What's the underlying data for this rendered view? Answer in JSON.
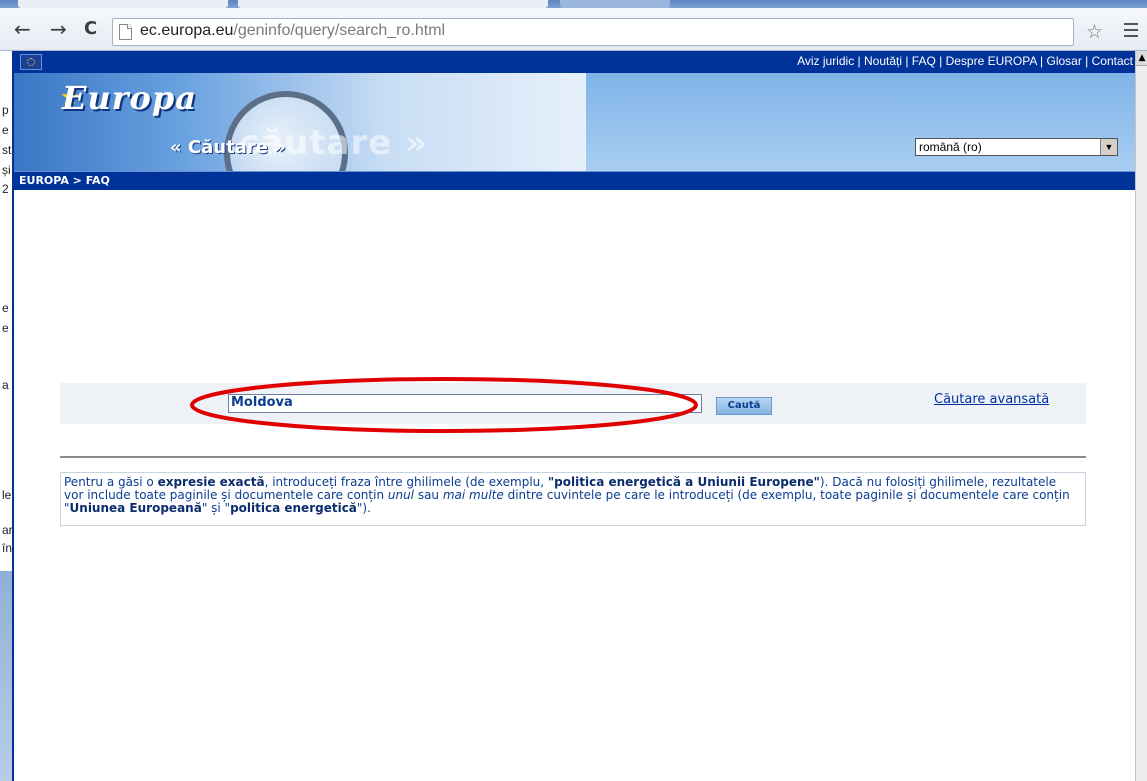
{
  "browser": {
    "back": "←",
    "forward": "→",
    "reload": "C",
    "url_host": "ec.europa.eu",
    "url_path": "/geninfo/query/search_ro.html",
    "star": "☆"
  },
  "behind_window_fragments": [
    "p",
    "e",
    "st",
    "și",
    "2",
    "e",
    "e",
    "a",
    "le",
    "ar",
    "în"
  ],
  "top_links": "Aviz juridic | Noutăți | FAQ | Despre EUROPA | Glosar | Contact",
  "banner": {
    "logo_text": "Europa",
    "section_title": "« Căutare »",
    "background_word": "căutare »"
  },
  "language_select": {
    "value": "română (ro)"
  },
  "breadcrumb": "EUROPA > FAQ",
  "search": {
    "value": "Moldova",
    "button": "Caută",
    "advanced_link": "Căutare avansată"
  },
  "help": {
    "t1": "Pentru a găsi o ",
    "b1": "expresie exactă",
    "t2": ", introduceți fraza între ghilimele (de exemplu, ",
    "b2": "\"politica energetică a Uniunii Europene\"",
    "t3": "). Dacă nu folosiți ghilimele, rezultatele vor include toate paginile și documentele care conțin ",
    "i1": "unul",
    "t4": " sau ",
    "i2": "mai multe",
    "t5": " dintre cuvintele pe care le introduceți (de exemplu, toate paginile și documentele care conțin \"",
    "b3": "Uniunea Europeană",
    "t6": "\" și \"",
    "b4": "politica energetică",
    "t7": "\")."
  },
  "colors": {
    "header_blue": "#003399",
    "annotation_red": "#e00000"
  }
}
